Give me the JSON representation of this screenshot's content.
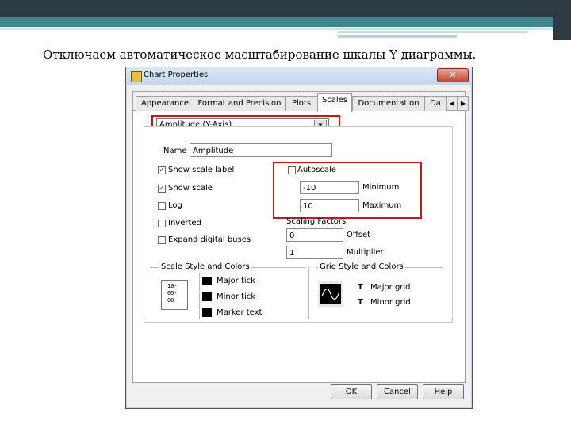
{
  "slide": {
    "caption": "Отключаем автоматическое масштабирование шкалы Y диаграммы."
  },
  "dialog": {
    "title": "Chart Properties",
    "close_label": "✕",
    "tabs": [
      {
        "label": "Appearance"
      },
      {
        "label": "Format and Precision"
      },
      {
        "label": "Plots"
      },
      {
        "label": "Scales"
      },
      {
        "label": "Documentation"
      },
      {
        "label": "Da"
      }
    ],
    "active_tab": "Scales",
    "axis_select": {
      "value": "Amplitude (Y-Axis)"
    },
    "name": {
      "label": "Name",
      "value": "Amplitude"
    },
    "checkboxes": [
      {
        "label": "Show scale label",
        "checked": true
      },
      {
        "label": "Show scale",
        "checked": true
      },
      {
        "label": "Log",
        "checked": false
      },
      {
        "label": "Inverted",
        "checked": false
      },
      {
        "label": "Expand digital buses",
        "checked": false
      }
    ],
    "autoscale": {
      "label": "Autoscale",
      "checked": false
    },
    "minimum": {
      "label": "Minimum",
      "value": "-10"
    },
    "maximum": {
      "label": "Maximum",
      "value": "10"
    },
    "scaling": {
      "title": "Scaling Factors",
      "offset_label": "Offset",
      "offset_value": "0",
      "multiplier_label": "Multiplier",
      "multiplier_value": "1"
    },
    "scale_style": {
      "title": "Scale Style and Colors",
      "preview_lines": [
        "10-",
        "05-",
        "00-"
      ],
      "items": [
        "Major tick",
        "Minor tick",
        "Marker text"
      ]
    },
    "grid_style": {
      "title": "Grid Style and Colors",
      "items": [
        "Major grid",
        "Minor grid"
      ],
      "glyph": "T"
    },
    "buttons": {
      "ok": "OK",
      "cancel": "Cancel",
      "help": "Help"
    },
    "colors": {
      "highlight": "#c8161d",
      "swatch": "#000000"
    }
  }
}
